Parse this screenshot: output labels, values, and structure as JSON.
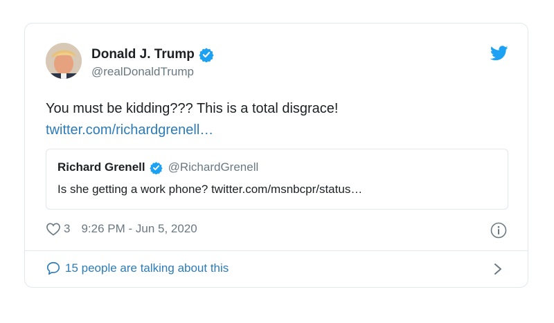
{
  "author": {
    "name": "Donald J. Trump",
    "handle": "@realDonaldTrump"
  },
  "tweet": {
    "text": "You must be kidding??? This is a total disgrace!",
    "link": "twitter.com/richardgrenell…"
  },
  "quoted_tweet": {
    "name": "Richard Grenell",
    "handle": "@RichardGrenell",
    "text": "Is she getting a work phone? twitter.com/msnbcpr/status…"
  },
  "meta": {
    "like_count": "3",
    "timestamp": "9:26 PM - Jun 5, 2020"
  },
  "conversation": {
    "label": "15 people are talking about this"
  },
  "icons": {
    "bird": "twitter-bird-icon",
    "verified": "verified-badge-icon",
    "heart": "heart-icon",
    "info": "info-icon",
    "bubble": "speech-bubble-icon",
    "chevron": "chevron-right-icon"
  },
  "colors": {
    "link": "#2b7bb9",
    "brand": "#1da1f2",
    "secondary_text": "#697882",
    "border": "#e1e8ed"
  }
}
